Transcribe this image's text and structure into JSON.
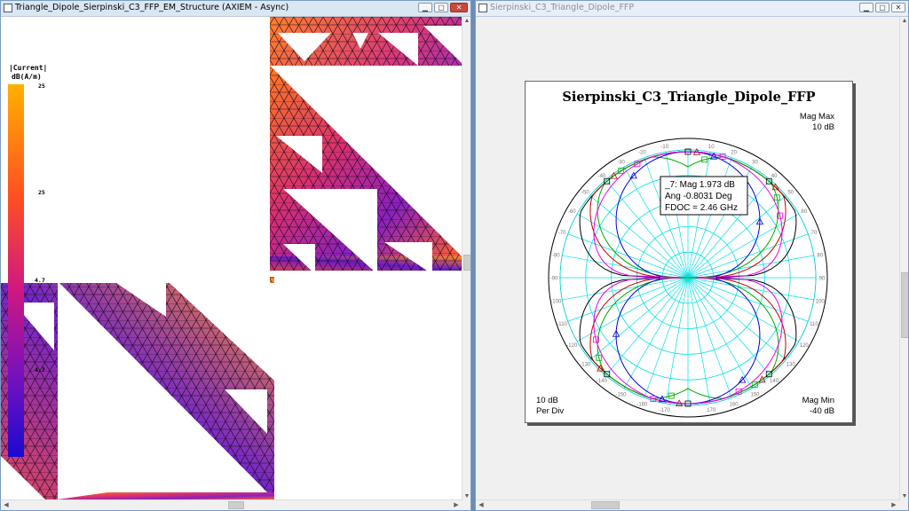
{
  "left_window": {
    "title": "Triangle_Dipole_Sierpinski_C3_FFP_EM_Structure (AXIEM - Async)",
    "legend": {
      "title": "|Current|",
      "unit": "dB(A/m)",
      "ticks": [
        "25",
        "25",
        "4.7",
        "4.7"
      ]
    }
  },
  "right_window": {
    "title": "Sierpinski_C3_Triangle_Dipole_FFP",
    "graph": {
      "title": "Sierpinski_C3_Triangle_Dipole_FFP",
      "mag_max_label": "Mag Max",
      "mag_max_value": "10 dB",
      "mag_min_label": "Mag Min",
      "mag_min_value": "-40 dB",
      "per_div_value": "10 dB",
      "per_div_label": "Per Div",
      "marker": {
        "line1": "_7: Mag 1.973 dB",
        "line2": "Ang -0.8031 Deg",
        "line3": "FDOC = 2.46 GHz"
      },
      "angle_labels": [
        "10",
        "20",
        "30",
        "40",
        "50",
        "60",
        "70",
        "80",
        "90",
        "100",
        "110",
        "120",
        "130",
        "140",
        "150",
        "160",
        "170",
        "-10",
        "-20",
        "-30",
        "-40",
        "-50",
        "-60",
        "-70",
        "-80",
        "-90",
        "-100",
        "-110",
        "-120",
        "-130",
        "-140",
        "-150",
        "-160",
        "-170"
      ]
    }
  },
  "colors": {
    "trace_black": "#000000",
    "trace_red": "#c00000",
    "trace_green": "#00aa00",
    "trace_blue": "#0000dd",
    "trace_magenta": "#ee00ee",
    "grid_cyan": "#00e0e8",
    "legend_top": "#ffb000",
    "legend_bottom": "#1a0ad0"
  }
}
